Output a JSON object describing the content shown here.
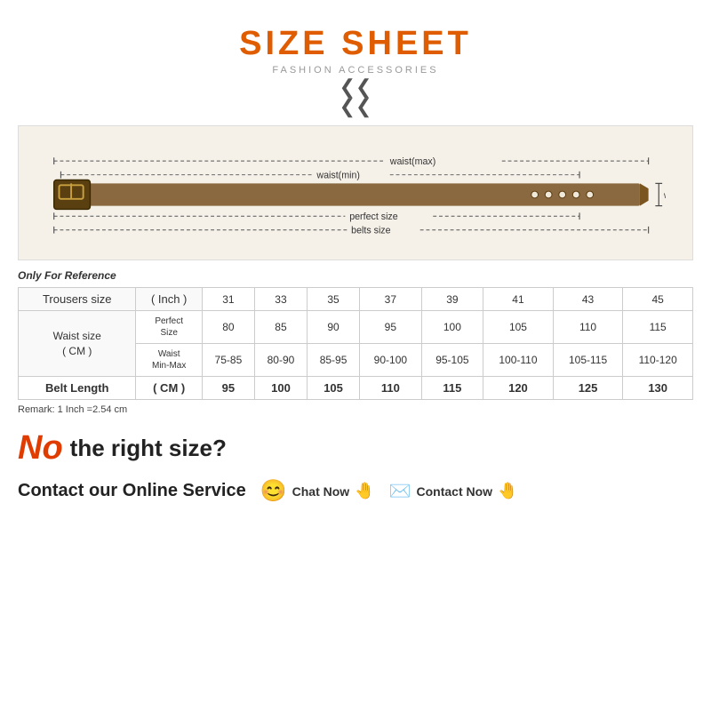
{
  "title": "SIZE SHEET",
  "subtitle": "FASHION ACCESSORIES",
  "chevrons": "❯❯",
  "only_ref": "Only For Reference",
  "remark": "Remark: 1 Inch =2.54 cm",
  "table": {
    "headers": [
      "Trousers size",
      "( Inch )",
      "31",
      "33",
      "35",
      "37",
      "39",
      "41",
      "43",
      "45"
    ],
    "waist_label": "Waist size\n( CM )",
    "perfect_label": "Perfect\nSize",
    "perfect_values": [
      "80",
      "85",
      "90",
      "95",
      "100",
      "105",
      "110",
      "115"
    ],
    "waist_min_label": "Waist\nMin-Max",
    "waist_values": [
      "75-85",
      "80-90",
      "85-95",
      "90-100",
      "95-105",
      "100-110",
      "105-115",
      "110-120"
    ],
    "belt_label": "Belt Length",
    "belt_unit": "( CM )",
    "belt_values": [
      "95",
      "100",
      "105",
      "110",
      "115",
      "120",
      "125",
      "130"
    ]
  },
  "no_size": {
    "no": "No",
    "right_size_text": "the right size?",
    "contact_label": "Contact our Online Service",
    "chat_now": "Chat Now",
    "contact_now": "Contact Now"
  },
  "belt_labels": {
    "waist_max": "waist(max)",
    "waist_min": "waist(min)",
    "perfect_size": "perfect size",
    "belts_size": "belts size",
    "width": "width"
  }
}
